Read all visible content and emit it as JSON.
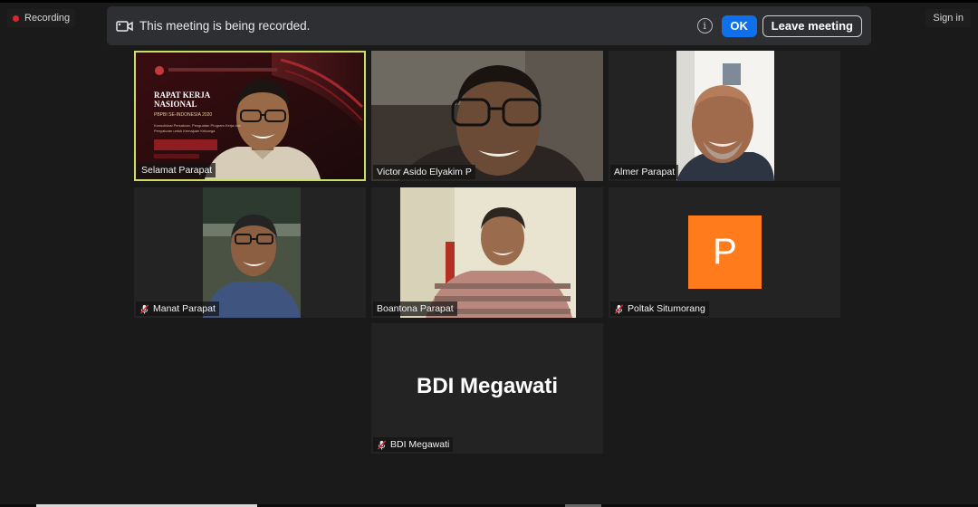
{
  "status": {
    "recording_label": "Recording",
    "signin_label": "Sign in"
  },
  "banner": {
    "message": "This meeting is being recorded.",
    "ok_label": "OK",
    "leave_label": "Leave meeting"
  },
  "participants": [
    {
      "name": "Selamat Parapat",
      "muted": false,
      "active": true
    },
    {
      "name": "Victor Asido Elyakim P",
      "muted": false,
      "active": false
    },
    {
      "name": "Almer Parapat",
      "muted": false,
      "active": false
    },
    {
      "name": "Manat Parapat",
      "muted": true,
      "active": false
    },
    {
      "name": "Boantona Parapat",
      "muted": false,
      "active": false
    },
    {
      "name": "Poltak Situmorang",
      "muted": true,
      "active": false,
      "avatar_letter": "P"
    },
    {
      "name": "BDI Megawati",
      "muted": true,
      "active": false,
      "display_name": "BDI Megawati"
    }
  ],
  "slide": {
    "title": "RAPAT KERJA NASIONAL",
    "subtitle": "PBPBI SE-INDONESIA 2020",
    "body": "Konsolidasi Persatuan, Penguatan Program Kerja dan Penyaluran untuk Kemajuan Keluarga"
  },
  "colors": {
    "accent": "#0e71eb",
    "active_border": "#c8e06a",
    "avatar_bg": "#ff7b1c",
    "recording_dot": "#e0242f"
  }
}
